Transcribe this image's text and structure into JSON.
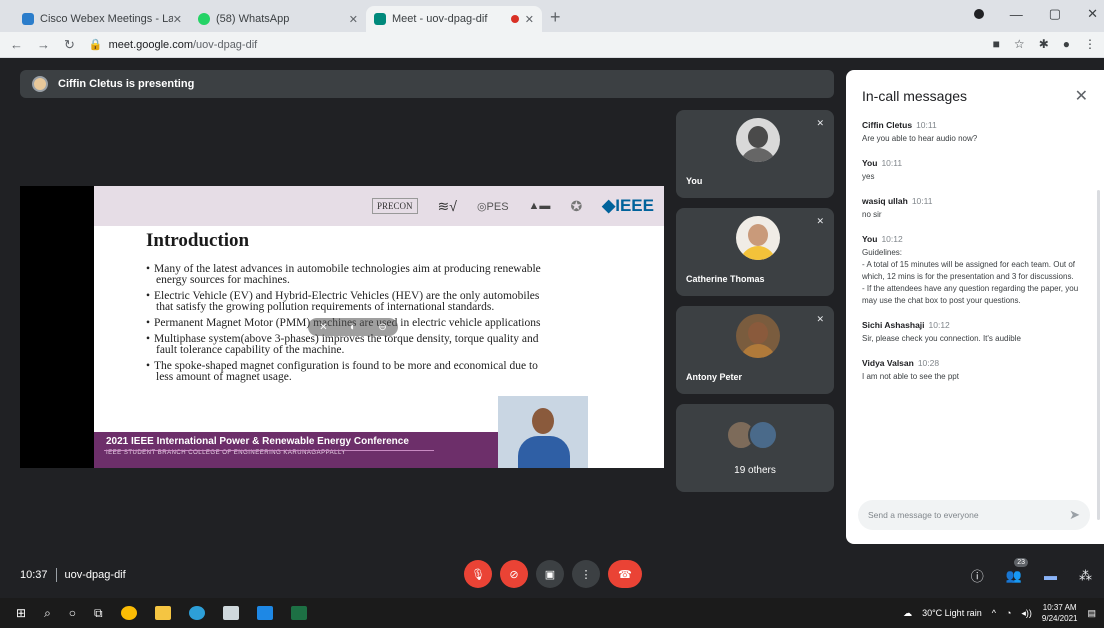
{
  "browser": {
    "tabs": [
      {
        "title": "Cisco Webex Meetings - Landing",
        "favicon_color": "#2b7dcb"
      },
      {
        "title": "(58) WhatsApp",
        "favicon_color": "#25d366"
      },
      {
        "title": "Meet - uov-dpag-dif",
        "favicon_color": "#00897b"
      }
    ],
    "new_tab": "+",
    "url_host": "meet.google.com",
    "url_path": "/uov-dpag-dif"
  },
  "meet": {
    "presenter_banner": "Ciffin Cletus is presenting",
    "slide": {
      "logos": [
        "PRECON",
        "IEEE"
      ],
      "title": "Introduction",
      "bullets": [
        "Many of the latest advances in automobile technologies aim at producing renewable energy sources for machines.",
        "Electric Vehicle (EV) and Hybrid-Electric Vehicles (HEV) are the only automobiles that satisfy the growing pollution requirements of international standards.",
        "Permanent Magnet Motor (PMM) machines are used in electric vehicle applications",
        "Multiphase system(above 3-phases) improves the torque density, torque quality and fault tolerance capability of the machine.",
        "The spoke-shaped magnet configuration is found to be more and economical due to less amount of magnet usage."
      ],
      "footer_title": "2021 IEEE International Power & Renewable Energy Conference",
      "footer_sub": "IEEE STUDENT BRANCH COLLEGE OF ENGINEERING KARUNAGAPPALLY"
    },
    "participants": [
      {
        "name": "You"
      },
      {
        "name": "Catherine Thomas"
      },
      {
        "name": "Antony Peter"
      },
      {
        "name": "19 others"
      }
    ],
    "chat": {
      "title": "In-call messages",
      "messages": [
        {
          "sender": "Ciffin Cletus",
          "time": "10:11",
          "text": "Are you able to hear audio now?"
        },
        {
          "sender": "You",
          "time": "10:11",
          "text": "yes"
        },
        {
          "sender": "wasiq ullah",
          "time": "10:11",
          "text": "no sir"
        },
        {
          "sender": "You",
          "time": "10:12",
          "text": "Guidelines:\n- A total of 15 minutes will be assigned for each team. Out of which, 12 mins is for the presentation and 3 for discussions.\n- If the attendees have any question regarding the paper, you may use the chat box to post your questions."
        },
        {
          "sender": "Sichi Ashashaji",
          "time": "10:12",
          "text": "Sir, please check you connection. It's audible"
        },
        {
          "sender": "Vidya Valsan",
          "time": "10:28",
          "text": "I am not able to see the ppt"
        }
      ],
      "input_placeholder": "Send a message to everyone"
    },
    "controls": {
      "time": "10:37",
      "meeting_code": "uov-dpag-dif",
      "participant_count": "23"
    }
  },
  "taskbar": {
    "weather": "30°C Light rain",
    "clock_time": "10:37 AM",
    "clock_date": "9/24/2021"
  },
  "colors": {
    "meet_bg": "#202124",
    "tile_bg": "#3c4043",
    "danger": "#ea4335",
    "slide_footer": "#6d2f6a",
    "ieee_blue": "#00629b"
  }
}
